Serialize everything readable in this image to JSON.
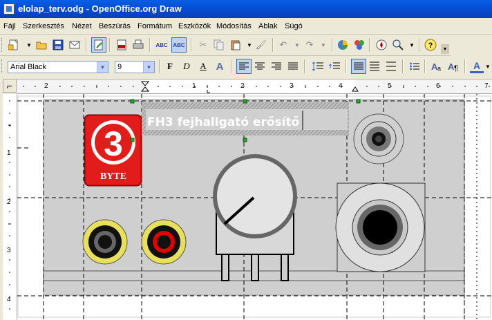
{
  "window": {
    "title": "elolap_terv.odg - OpenOffice.org Draw"
  },
  "menu": [
    "Fájl",
    "Szerkesztés",
    "Nézet",
    "Beszúrás",
    "Formátum",
    "Eszközök",
    "Módosítás",
    "Ablak",
    "Súgó"
  ],
  "toolbar": {
    "font_name": "Arial Black",
    "font_size": "9",
    "bold": "F",
    "italic": "D",
    "underline": "A",
    "shadow": "A",
    "font_color": "A"
  },
  "rulers": {
    "horizontal": [
      "2",
      "1",
      "1",
      "2",
      "3",
      "4",
      "5",
      "6",
      "7"
    ],
    "vertical": [
      "1",
      "2",
      "3",
      "4"
    ]
  },
  "drawing": {
    "logo_number": "3",
    "logo_text": "BYTE",
    "heading": "FH3  fejhallgató erősítő"
  },
  "colors": {
    "titlebar": "#0550d8",
    "panel": "#cfcfcf",
    "logo_red": "#e21b1b",
    "jack_yellow": "#e8e05a",
    "jack_red": "#e00000",
    "selection_handle": "#22aa22"
  }
}
